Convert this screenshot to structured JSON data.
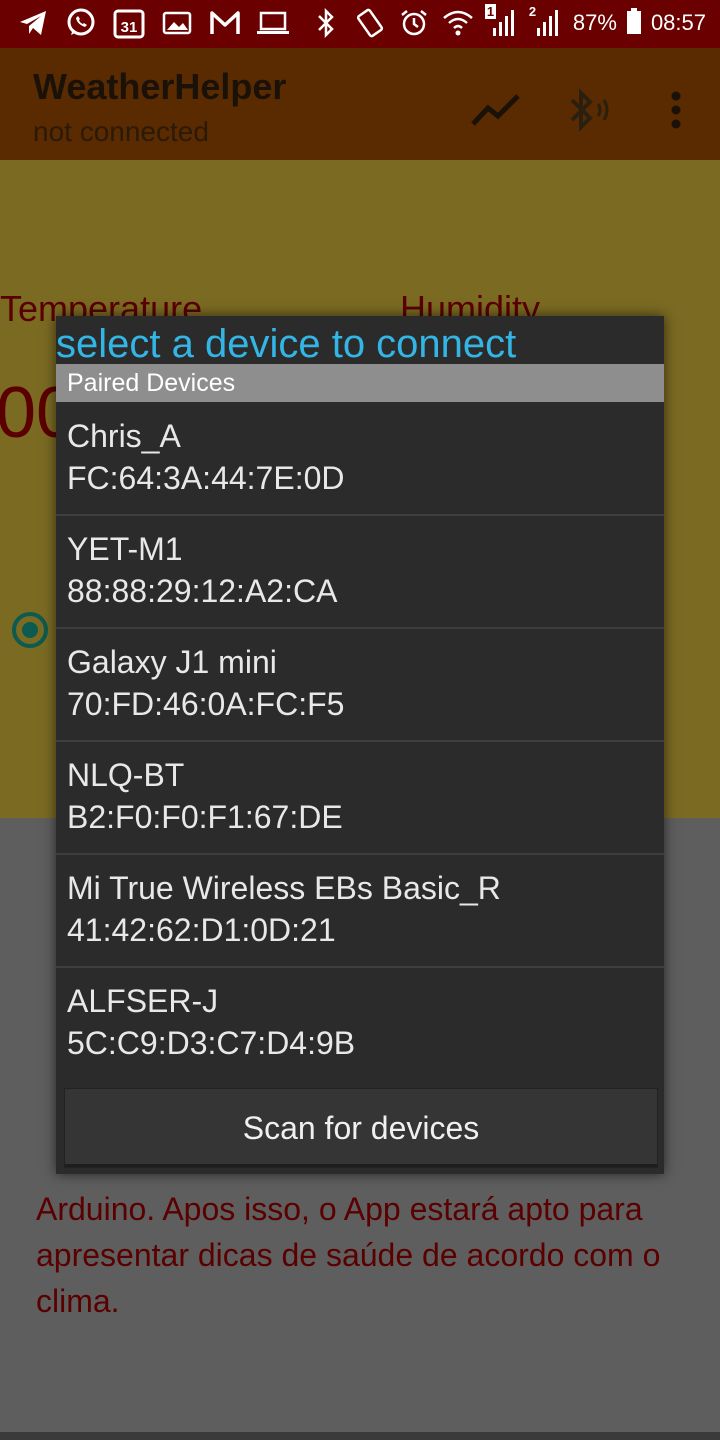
{
  "status_bar": {
    "battery_percent": "87%",
    "time": "08:57",
    "sim1_badge": "1",
    "sim2_badge": "2",
    "left_icons": [
      "telegram-icon",
      "whatsapp-icon",
      "calendar-icon",
      "gallery-icon",
      "gmail-icon",
      "laptop-icon"
    ],
    "right_icons": [
      "bluetooth-icon",
      "rotate-icon",
      "alarm-icon",
      "wifi-icon",
      "signal-icon",
      "signal-icon",
      "battery-icon"
    ]
  },
  "calendar_day": "31",
  "app_bar": {
    "title": "WeatherHelper",
    "subtitle": "not connected",
    "actions": [
      "chart-icon",
      "bluetooth-audio-icon",
      "more-vert-icon"
    ]
  },
  "main": {
    "temperature_label": "Temperature",
    "humidity_label": "Humidity",
    "temperature_value_visible": "00",
    "info_text_visible": "Arduino. Apos isso, o App estará apto para apresentar dicas de saúde de acordo com o clima."
  },
  "dialog": {
    "title": "select a device to connect",
    "section_header": "Paired Devices",
    "devices": [
      {
        "name": "Chris_A",
        "address": "FC:64:3A:44:7E:0D"
      },
      {
        "name": "YET-M1",
        "address": "88:88:29:12:A2:CA"
      },
      {
        "name": "Galaxy J1 mini",
        "address": "70:FD:46:0A:FC:F5"
      },
      {
        "name": "NLQ-BT",
        "address": "B2:F0:F0:F1:67:DE"
      },
      {
        "name": "Mi True Wireless EBs Basic_R",
        "address": "41:42:62:D1:0D:21"
      },
      {
        "name": "ALFSER-J",
        "address": "5C:C9:D3:C7:D4:9B"
      }
    ],
    "scan_button": "Scan for devices"
  },
  "colors": {
    "status_bar": "#6b0000",
    "app_bar": "#5a2a00",
    "dialog_bg": "#2b2b2b",
    "dialog_title": "#33b5e5",
    "accent_text": "#5a0000"
  }
}
